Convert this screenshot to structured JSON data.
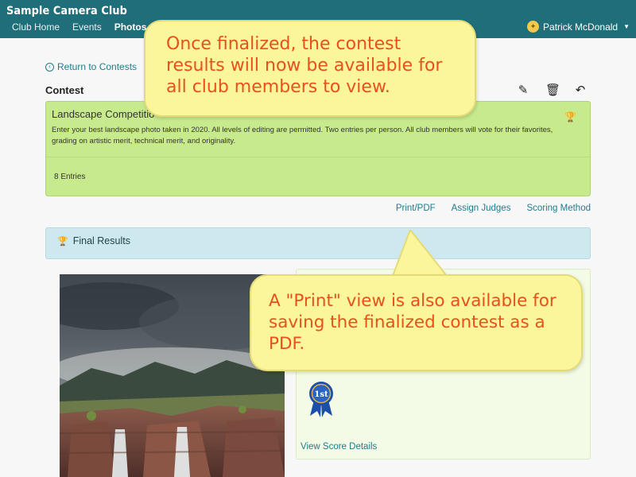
{
  "app": {
    "title": "Sample Camera Club"
  },
  "nav": {
    "items": [
      {
        "label": "Club Home"
      },
      {
        "label": "Events"
      },
      {
        "label": "Photos"
      }
    ]
  },
  "user": {
    "name": "Patrick McDonald",
    "avatar_icon": "key-icon"
  },
  "back_link": {
    "label": "Return to Contests"
  },
  "section_heading": "Contest",
  "contest": {
    "title": "Landscape Competitio",
    "description": "Enter your best landscape photo taken in 2020. All levels of editing are permitted. Two entries per person. All club members will vote for their favorites, grading on artistic merit, technical merit, and originality.",
    "entries": "8 Entries",
    "card_color": "#c7ea8c"
  },
  "actions": {
    "edit_icon": "pencil-icon",
    "delete_icon": "trash-icon",
    "undo_icon": "undo-icon"
  },
  "links": {
    "print": "Print/PDF",
    "judges": "Assign Judges",
    "scoring": "Scoring Method"
  },
  "results": {
    "title": "Final Results",
    "panel_color": "#cde9ef"
  },
  "winner": {
    "rank": "1st",
    "view_score": "View Score Details"
  },
  "callouts": {
    "top": "Once finalized, the contest results will now be available for all club members to view.",
    "bottom": "A \"Print\" view is also available for saving the finalized contest as a PDF."
  },
  "colors": {
    "brand": "#1f6f7a",
    "link": "#1f7c8a",
    "callout_text": "#e8501c",
    "callout_bg": "#fbf59b"
  }
}
